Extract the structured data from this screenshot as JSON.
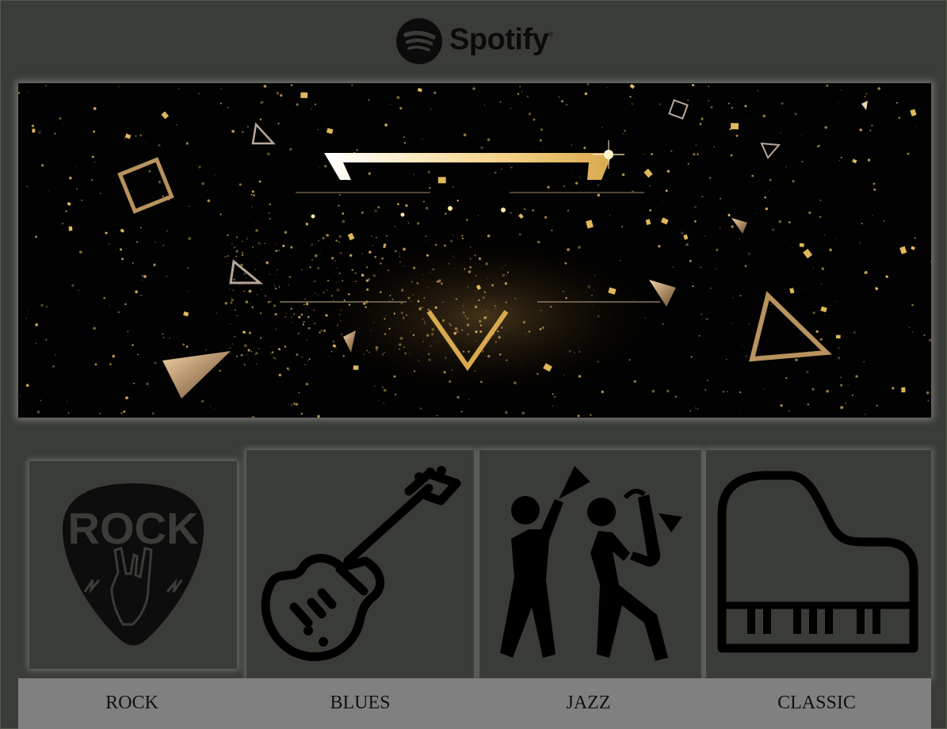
{
  "header": {
    "logo_icon": "spotify-logo-icon",
    "logo_text": "Spotify",
    "logo_reg": "®"
  },
  "banner": {
    "description": "decorative-gold-triangle-particles-banner",
    "colors": {
      "background": "#020202",
      "gold": "#d9b36a"
    }
  },
  "genres": [
    {
      "label": "ROCK",
      "icon": "rock-guitar-pick-icon",
      "pick_text": "ROCK"
    },
    {
      "label": "BLUES",
      "icon": "electric-guitar-icon"
    },
    {
      "label": "JAZZ",
      "icon": "jazz-musicians-icon"
    },
    {
      "label": "CLASSIC",
      "icon": "grand-piano-icon"
    }
  ],
  "colors": {
    "page_bg": "#3a3d37",
    "label_bar": "#808080",
    "icon": "#000000"
  }
}
